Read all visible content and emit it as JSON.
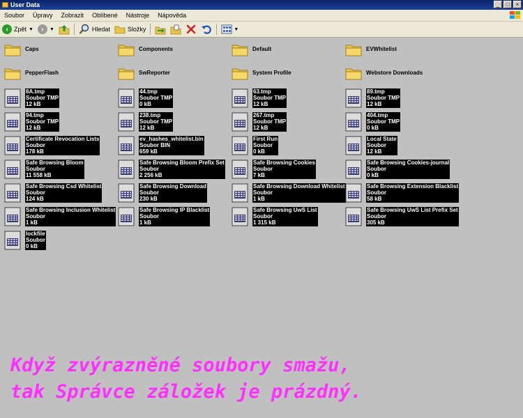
{
  "window": {
    "title": "User Data"
  },
  "menu": [
    "Soubor",
    "Úpravy",
    "Zobrazit",
    "Oblíbené",
    "Nástroje",
    "Nápověda"
  ],
  "toolbar": {
    "back": "Zpět",
    "search": "Hledat",
    "folders": "Složky"
  },
  "folders": [
    "Caps",
    "Components",
    "Default",
    "EVWhitelist",
    "PepperFlash",
    "SwReporter",
    "System Profile",
    "Webstore Downloads"
  ],
  "files": [
    {
      "name": "8A.tmp",
      "type": "Soubor TMP",
      "size": "12 kB"
    },
    {
      "name": "44.tmp",
      "type": "Soubor TMP",
      "size": "0 kB"
    },
    {
      "name": "63.tmp",
      "type": "Soubor TMP",
      "size": "12 kB"
    },
    {
      "name": "89.tmp",
      "type": "Soubor TMP",
      "size": "12 kB"
    },
    {
      "name": "94.tmp",
      "type": "Soubor TMP",
      "size": "12 kB"
    },
    {
      "name": "238.tmp",
      "type": "Soubor TMP",
      "size": "12 kB"
    },
    {
      "name": "267.tmp",
      "type": "Soubor TMP",
      "size": "12 kB"
    },
    {
      "name": "404.tmp",
      "type": "Soubor TMP",
      "size": "0 kB"
    },
    {
      "name": "Certificate Revocation Lists",
      "type": "Soubor",
      "size": "178 kB"
    },
    {
      "name": "ev_hashes_whitelist.bin",
      "type": "Soubor BIN",
      "size": "659 kB"
    },
    {
      "name": "First Run",
      "type": "Soubor",
      "size": "0 kB"
    },
    {
      "name": "Local State",
      "type": "Soubor",
      "size": "12 kB"
    },
    {
      "name": "Safe Browsing Bloom",
      "type": "Soubor",
      "size": "11 558 kB"
    },
    {
      "name": "Safe Browsing Bloom Prefix Set",
      "type": "Soubor",
      "size": "2 256 kB"
    },
    {
      "name": "Safe Browsing Cookies",
      "type": "Soubor",
      "size": "7 kB"
    },
    {
      "name": "Safe Browsing Cookies-journal",
      "type": "Soubor",
      "size": "0 kB"
    },
    {
      "name": "Safe Browsing Csd Whitelist",
      "type": "Soubor",
      "size": "124 kB"
    },
    {
      "name": "Safe Browsing Download",
      "type": "Soubor",
      "size": "230 kB"
    },
    {
      "name": "Safe Browsing Download Whitelist",
      "type": "Soubor",
      "size": "1 kB"
    },
    {
      "name": "Safe Browsing Extension Blacklist",
      "type": "Soubor",
      "size": "58 kB"
    },
    {
      "name": "Safe Browsing Inclusion Whitelist",
      "type": "Soubor",
      "size": "1 kB"
    },
    {
      "name": "Safe Browsing IP Blacklist",
      "type": "Soubor",
      "size": "1 kB"
    },
    {
      "name": "Safe Browsing UwS List",
      "type": "Soubor",
      "size": "1 315 kB"
    },
    {
      "name": "Safe Browsing UwS List Prefix Set",
      "type": "Soubor",
      "size": "305 kB"
    },
    {
      "name": "lockfile",
      "type": "Soubor",
      "size": "0 kB"
    }
  ],
  "caption": {
    "line1": "Když zvýrazněné soubory smažu,",
    "line2": "tak Správce záložek je prázdný."
  },
  "colors": {
    "caption": "#ff30ff",
    "titlebar": "#0a246a",
    "desktop": "#c0c0c0"
  }
}
